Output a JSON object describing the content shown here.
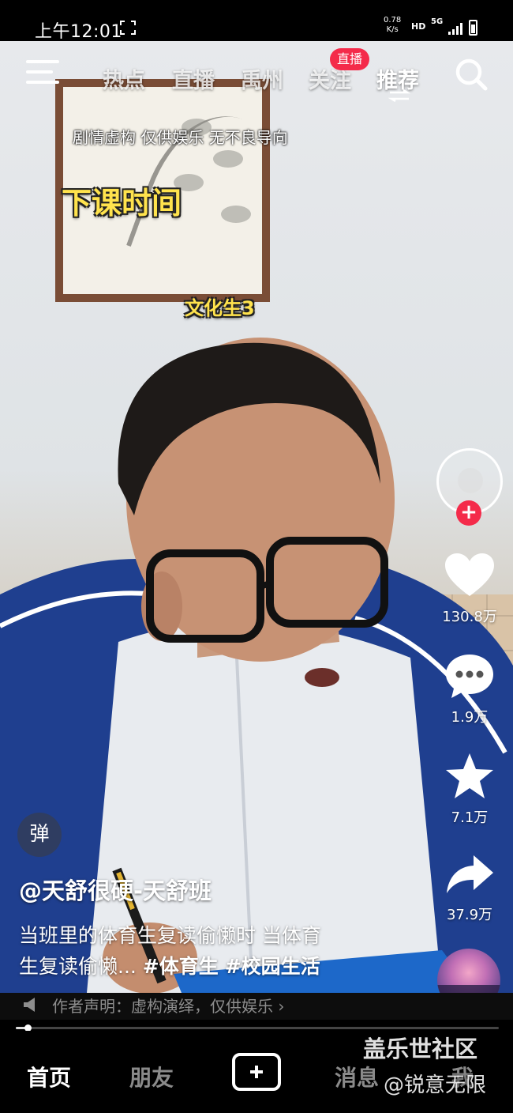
{
  "status_bar": {
    "time": "上午12:01",
    "net_speed_value": "0.78",
    "net_speed_unit": "K/s",
    "hd": "HD",
    "network": "5G"
  },
  "top_nav": {
    "tabs": [
      "热点",
      "直播",
      "禹州",
      "关注",
      "推荐"
    ],
    "active_tab": "推荐",
    "live_badge": "直播"
  },
  "video": {
    "disclaimer": "剧情虚构 仅供娱乐 无不良导向",
    "caption_main": "下课时间",
    "caption_sub": "文化生3"
  },
  "actions": {
    "likes": "130.8万",
    "comments": "1.9万",
    "favorites": "7.1万",
    "shares": "37.9万"
  },
  "info": {
    "danmu_label": "弹",
    "author": "@天舒很硬-天舒班",
    "desc_line1": "当班里的体育生复读偷懒时 当体育",
    "desc_line2": "生复读偷懒...",
    "hashtags": [
      "#体育生",
      "#校园生活"
    ],
    "declaration": "作者声明：虚构演绎，仅供娱乐 ›"
  },
  "progress": {
    "fraction": 0.025
  },
  "bottom_nav": {
    "items": [
      "首页",
      "朋友",
      "消息",
      "我"
    ],
    "active": "首页"
  },
  "watermark": {
    "line1": "盖乐世社区",
    "line2": "@锐意无限"
  },
  "colors": {
    "accent_red": "#f42b4a",
    "caption_yellow": "#ffe34d"
  }
}
